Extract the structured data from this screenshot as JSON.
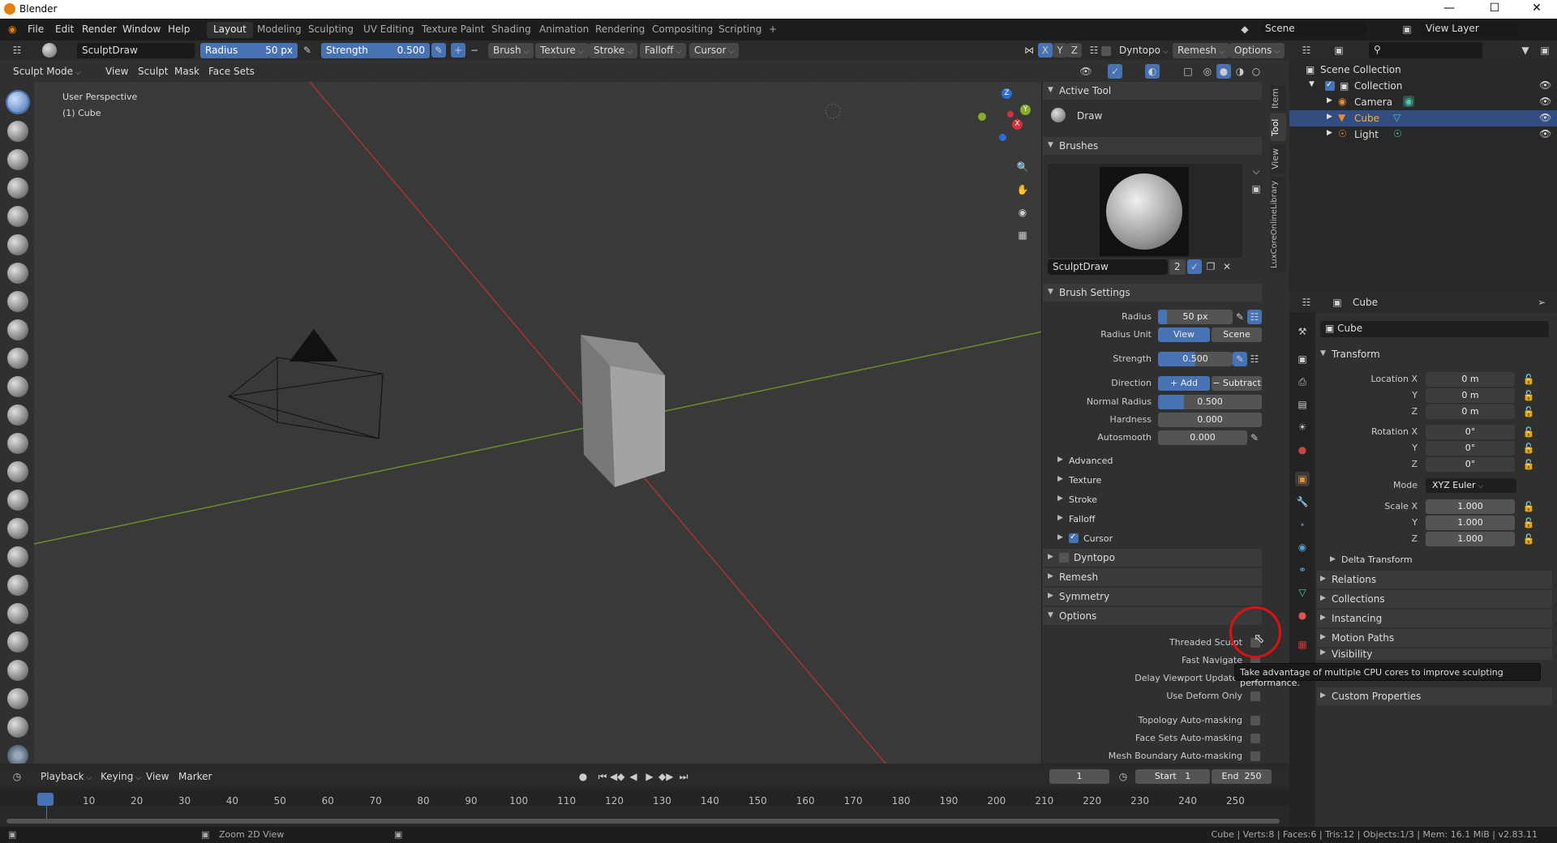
{
  "window": {
    "title": "Blender",
    "minimize": "—",
    "maximize": "☐",
    "close": "✕"
  },
  "menus": [
    "File",
    "Edit",
    "Render",
    "Window",
    "Help"
  ],
  "workspaces": [
    "Layout",
    "Modeling",
    "Sculpting",
    "UV Editing",
    "Texture Paint",
    "Shading",
    "Animation",
    "Rendering",
    "Compositing",
    "Scripting"
  ],
  "workspace_add": "+",
  "scene": {
    "name": "Scene",
    "view_layer": "View Layer"
  },
  "tool_header": {
    "brush_name": "SculptDraw",
    "radius_label": "Radius",
    "radius_value": "50 px",
    "strength_label": "Strength",
    "strength_value": "0.500",
    "brush_menu": "Brush",
    "texture_menu": "Texture",
    "stroke_menu": "Stroke",
    "falloff_menu": "Falloff",
    "cursor_menu": "Cursor",
    "axis_x": "X",
    "axis_y": "Y",
    "axis_z": "Z",
    "dyntopo": "Dyntopo",
    "remesh": "Remesh",
    "options": "Options"
  },
  "view_header": {
    "mode": "Sculpt Mode",
    "menus": [
      "View",
      "Sculpt",
      "Mask",
      "Face Sets"
    ]
  },
  "viewport": {
    "perspective": "User Perspective",
    "object": "(1) Cube",
    "gizmo_x": "X",
    "gizmo_y": "Y",
    "gizmo_z": "Z"
  },
  "sidebar_tabs": [
    "Item",
    "Tool",
    "View",
    "LuxCoreOnlineLibrary"
  ],
  "sidebar": {
    "active_tool_title": "Active Tool",
    "active_tool_name": "Draw",
    "brushes_title": "Brushes",
    "brush_name": "SculptDraw",
    "brush_users": "2",
    "brush_settings_title": "Brush Settings",
    "radius_label": "Radius",
    "radius_value": "50 px",
    "radius_unit_label": "Radius Unit",
    "radius_unit_view": "View",
    "radius_unit_scene": "Scene",
    "strength_label": "Strength",
    "strength_value": "0.500",
    "direction_label": "Direction",
    "direction_add": "Add",
    "direction_subtract": "Subtract",
    "normal_radius_label": "Normal Radius",
    "normal_radius_value": "0.500",
    "hardness_label": "Hardness",
    "hardness_value": "0.000",
    "autosmooth_label": "Autosmooth",
    "autosmooth_value": "0.000",
    "subpanels": [
      "Advanced",
      "Texture",
      "Stroke",
      "Falloff",
      "Cursor"
    ],
    "dyntopo_title": "Dyntopo",
    "remesh_title": "Remesh",
    "symmetry_title": "Symmetry",
    "options_title": "Options",
    "options": [
      "Threaded Sculpt",
      "Fast Navigate",
      "Delay Viewport Updates",
      "Use Deform Only",
      "Topology Auto-masking",
      "Face Sets Auto-masking",
      "Mesh Boundary Auto-masking"
    ]
  },
  "tooltip": "Take advantage of multiple CPU cores to improve sculpting performance.",
  "outliner": {
    "root": "Scene Collection",
    "collection": "Collection",
    "items": [
      "Camera",
      "Cube",
      "Light"
    ]
  },
  "properties": {
    "object_name": "Cube",
    "data_name": "Cube",
    "transform_title": "Transform",
    "location_x_label": "Location X",
    "y_label": "Y",
    "z_label": "Z",
    "location": [
      "0 m",
      "0 m",
      "0 m"
    ],
    "rotation_x_label": "Rotation X",
    "rotation": [
      "0°",
      "0°",
      "0°"
    ],
    "mode_label": "Mode",
    "mode_value": "XYZ Euler",
    "scale_x_label": "Scale X",
    "scale": [
      "1.000",
      "1.000",
      "1.000"
    ],
    "delta_transform": "Delta Transform",
    "panels": [
      "Relations",
      "Collections",
      "Instancing",
      "Motion Paths",
      "Visibility"
    ],
    "custom_properties": "Custom Properties"
  },
  "timeline": {
    "menus": [
      "Playback",
      "Keying",
      "View",
      "Marker"
    ],
    "current_frame": "1",
    "start_label": "Start",
    "start": "1",
    "end_label": "End",
    "end": "250",
    "ticks": [
      "1",
      "10",
      "20",
      "30",
      "40",
      "50",
      "60",
      "70",
      "80",
      "90",
      "100",
      "110",
      "120",
      "130",
      "140",
      "150",
      "160",
      "170",
      "180",
      "190",
      "200",
      "210",
      "220",
      "230",
      "240",
      "250"
    ]
  },
  "status": {
    "hint": "Zoom 2D View",
    "stats": "Cube | Verts:8 | Faces:6 | Tris:12 | Objects:1/3 | Mem: 16.1 MiB | v2.83.11"
  }
}
